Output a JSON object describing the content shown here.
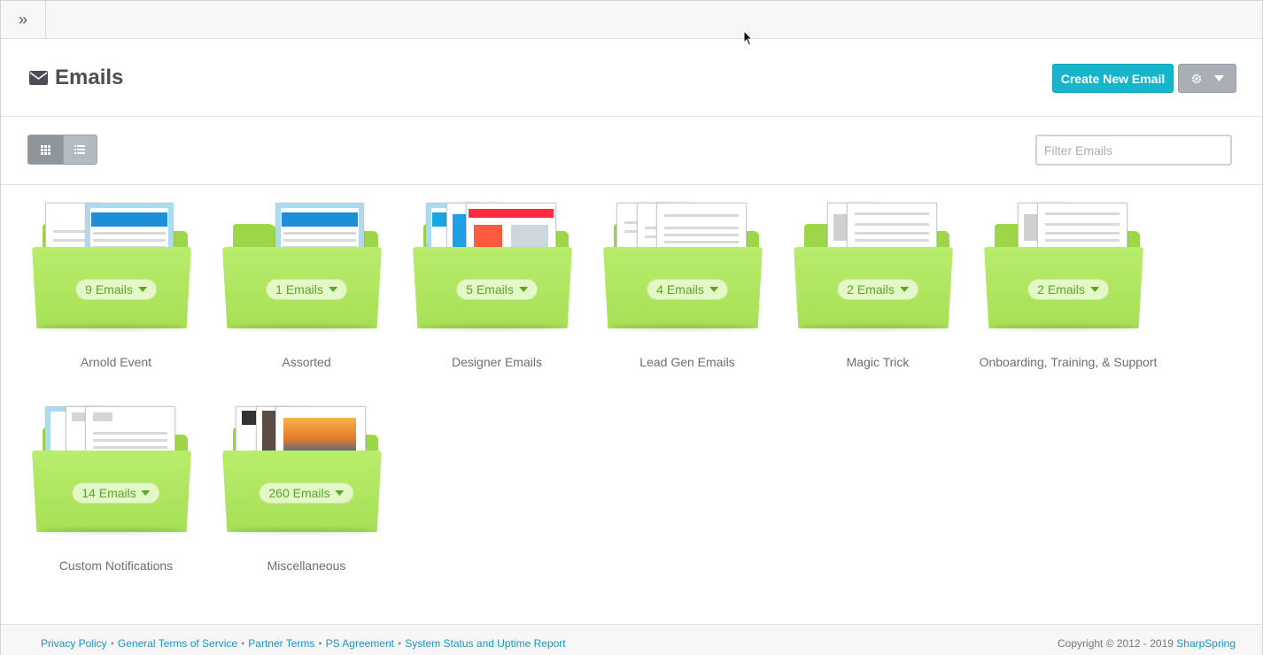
{
  "topbar": {
    "expand_icon": "double-chevron-right-icon",
    "expand_glyph": "»"
  },
  "header": {
    "title": "Emails",
    "title_icon": "envelope-icon",
    "create_button": "Create New Email",
    "settings_icon": "gear-icon"
  },
  "toolbar": {
    "grid_view_icon": "grid-icon",
    "list_view_icon": "list-icon",
    "filter_placeholder": "Filter Emails"
  },
  "folders": [
    {
      "label": "Arnold Event",
      "count": "9 Emails"
    },
    {
      "label": "Assorted",
      "count": "1 Emails"
    },
    {
      "label": "Designer Emails",
      "count": "5 Emails"
    },
    {
      "label": "Lead Gen Emails",
      "count": "4 Emails"
    },
    {
      "label": "Magic Trick",
      "count": "2 Emails"
    },
    {
      "label": "Onboarding, Training, & Support",
      "count": "2 Emails"
    },
    {
      "label": "Custom Notifications",
      "count": "14 Emails"
    },
    {
      "label": "Miscellaneous",
      "count": "260 Emails"
    }
  ],
  "footer": {
    "links": [
      "Privacy Policy",
      "General Terms of Service",
      "Partner Terms",
      "PS Agreement",
      "System Status and Uptime Report"
    ],
    "separator": "•",
    "copyright_prefix": "Copyright © 2012 - 2019",
    "copyright_brand": "SharpSpring"
  },
  "colors": {
    "accent": "#17b5cc",
    "folder_green": "#a7e055",
    "pill_text": "#5aa626",
    "link": "#1596c6"
  }
}
